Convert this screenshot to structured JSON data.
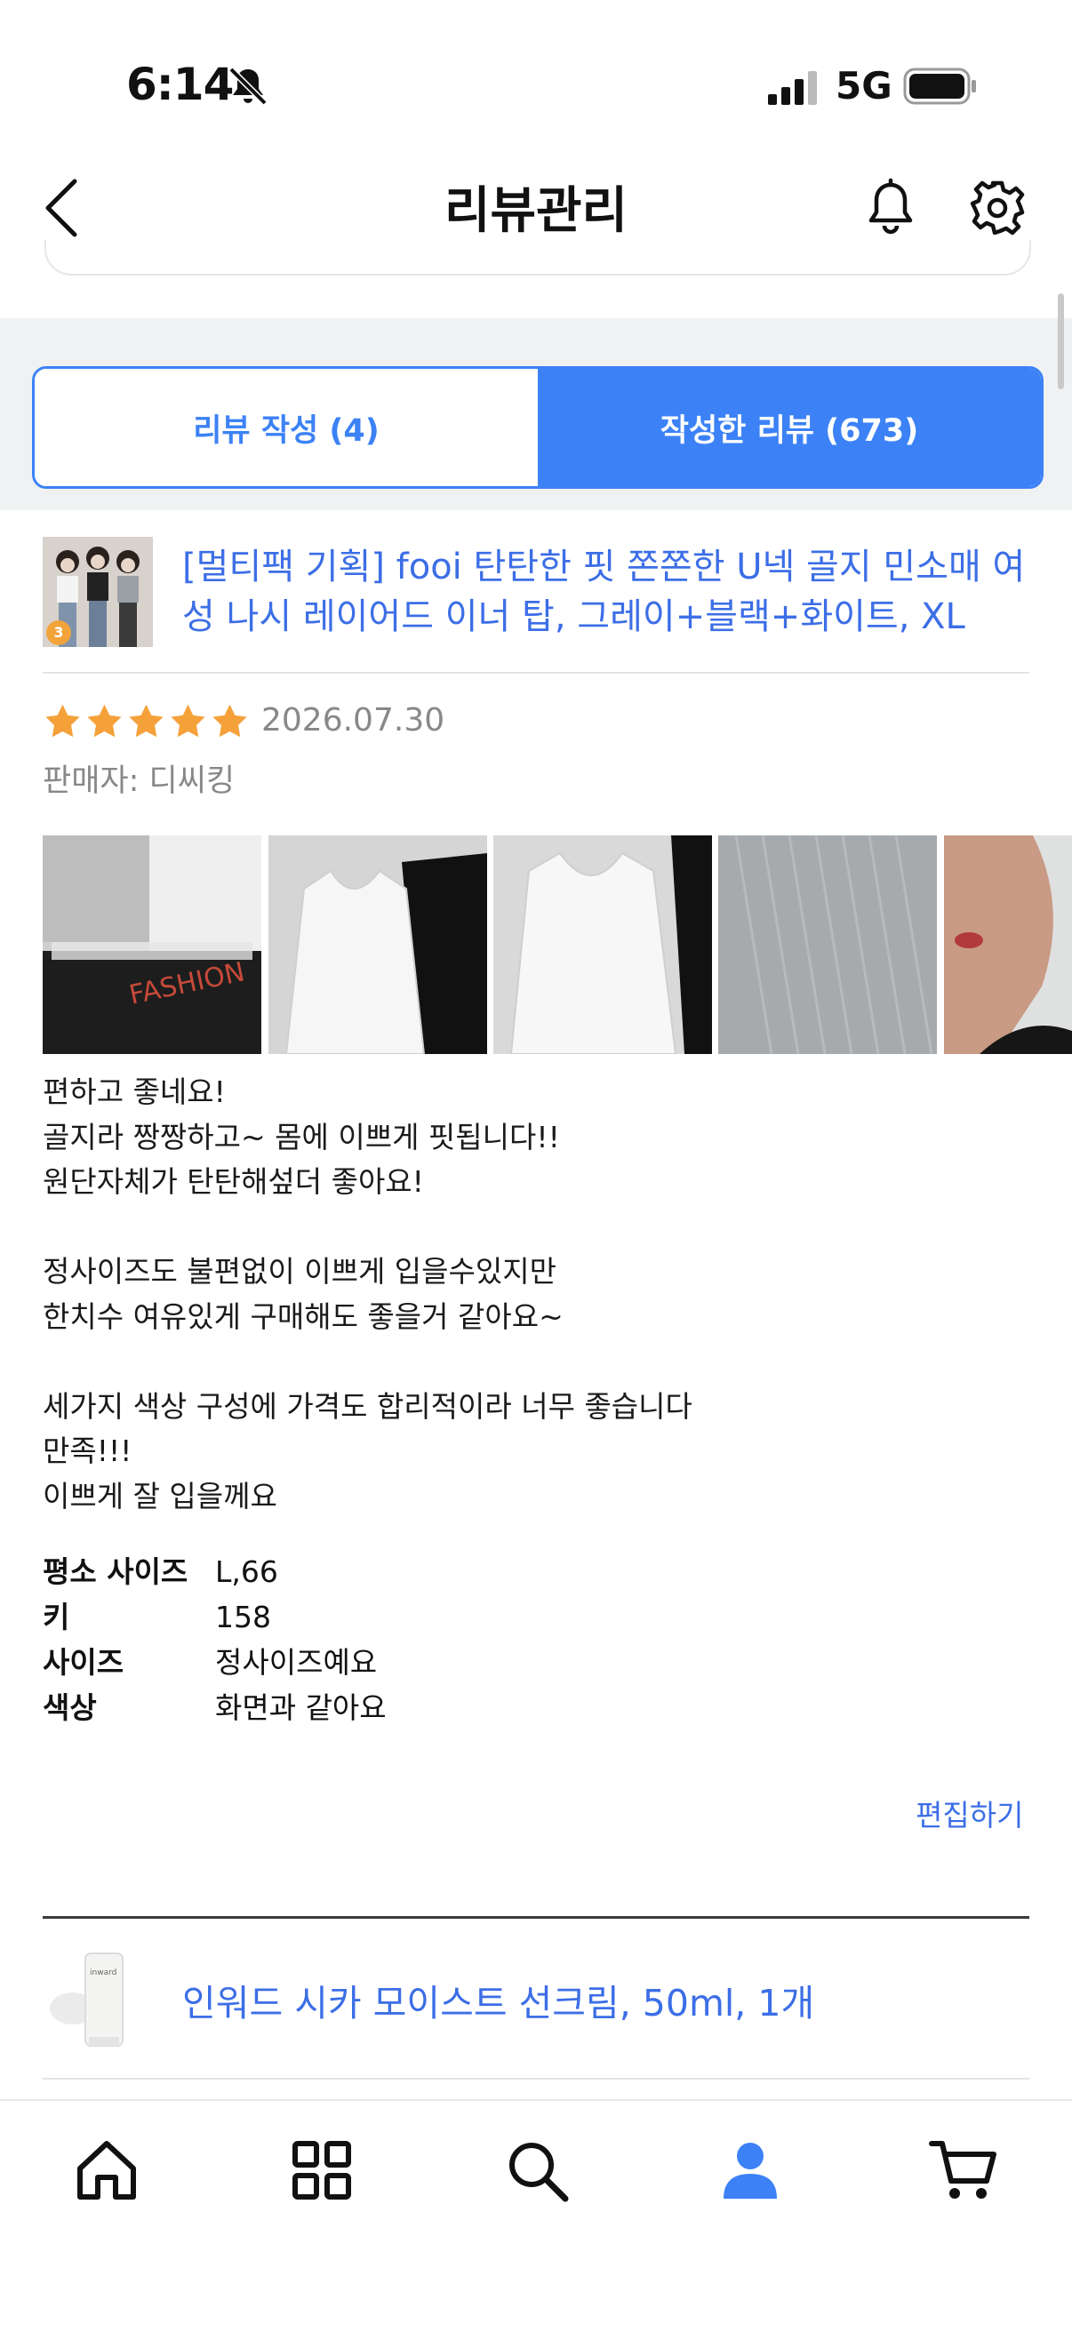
{
  "status_bar": {
    "time": "6:14",
    "network": "5G"
  },
  "header": {
    "title": "리뷰관리"
  },
  "tabs": [
    {
      "label": "리뷰 작성 (4)",
      "active": false
    },
    {
      "label": "작성한 리뷰 (673)",
      "active": true
    }
  ],
  "review": {
    "product_title": "[멀티팩 기획] fooi 탄탄한 핏 쫀쫀한 U넥 골지 민소매 여성 나시 레이어드 이너 탑, 그레이+블랙+화이트, XL",
    "rating": 5,
    "date": "2026.07.30",
    "seller": "판매자: 디씨킹",
    "thumb_badge": "3",
    "text": "편하고 좋네요!\n골지라 짱짱하고~ 몸에 이쁘게 핏됩니다!!\n원단자체가 탄탄해섶더 좋아요!\n\n정사이즈도 불편없이 이쁘게 입을수있지만\n한치수 여유있게 구매해도 좋을거 같아요~\n\n세가지 색상 구성에 가격도 합리적이라 너무 좋습니다\n만족!!!\n이쁘게 잘 입을께요",
    "specs": [
      {
        "label": "평소 사이즈",
        "value": "L,66"
      },
      {
        "label": "키",
        "value": "158"
      },
      {
        "label": "사이즈",
        "value": "정사이즈예요"
      },
      {
        "label": "색상",
        "value": "화면과 같아요"
      }
    ],
    "edit_label": "편집하기",
    "photo_text": "FASHION"
  },
  "next_review": {
    "product_title": "인워드 시카 모이스트 선크림, 50ml, 1개",
    "thumb_brand": "inward"
  },
  "colors": {
    "accent": "#3c82f6",
    "link": "#3c6ee6",
    "star": "#f5a13a",
    "muted": "#888888"
  },
  "bottom_nav": [
    {
      "icon": "home-icon",
      "active": false
    },
    {
      "icon": "category-grid-icon",
      "active": false
    },
    {
      "icon": "search-icon",
      "active": false
    },
    {
      "icon": "profile-icon",
      "active": true
    },
    {
      "icon": "cart-icon",
      "active": false
    }
  ]
}
